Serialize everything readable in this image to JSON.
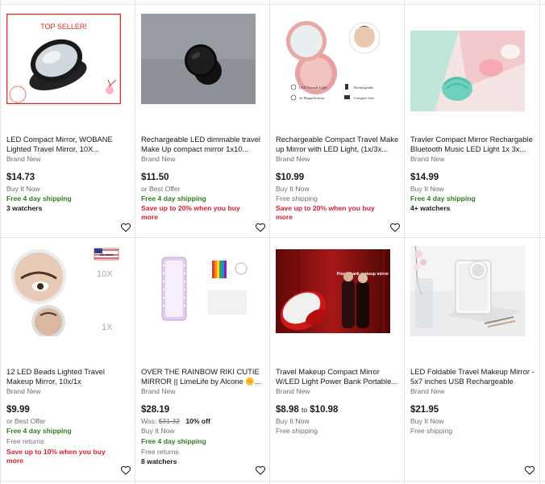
{
  "listings": [
    {
      "title": "LED Compact Mirror, WOBANE Lighted Travel Mirror, 10X...",
      "condition": "Brand New",
      "price": "$14.73",
      "lines": [
        {
          "text": "Buy It Now",
          "style": "gray"
        },
        {
          "text": "Free 4 day shipping",
          "style": "green"
        },
        {
          "text": "3 watchers",
          "style": "bold"
        }
      ],
      "badge_text": "TOP SELLER!",
      "badge_color": "#e0281e"
    },
    {
      "title": "Rechargeable LED dimmable travel Make Up compact mirror 1x10...",
      "condition": "Brand New",
      "price": "$11.50",
      "lines": [
        {
          "text": "or Best Offer",
          "style": "gray"
        },
        {
          "text": "Free 4 day shipping",
          "style": "green"
        },
        {
          "text": "Save up to 20% when you buy more",
          "style": "red"
        }
      ]
    },
    {
      "title": "Rechargeable Compact Travel Make up Mirror with LED Light, (1x/3x...",
      "condition": "Brand New",
      "price": "$10.99",
      "lines": [
        {
          "text": "Buy It Now",
          "style": "gray"
        },
        {
          "text": "Free shipping",
          "style": "gray"
        },
        {
          "text": "Save up to 20% when you buy more",
          "style": "red"
        }
      ],
      "image_labels": {
        "led": "LED Natural Light",
        "rechargeable": "Rechargeable",
        "magnification": "3x Magnification",
        "compact": "Compact Size"
      }
    },
    {
      "title": "Travler Compact Mirror Rechargable Bluetooth Music LED Light 1x 3x...",
      "condition": "Brand New",
      "price": "$14.99",
      "lines": [
        {
          "text": "Buy It Now",
          "style": "gray"
        },
        {
          "text": "Free 4 day shipping",
          "style": "green"
        },
        {
          "text": "4+ watchers",
          "style": "bold"
        }
      ]
    },
    {
      "title": "12 LED Beads Lighted Travel Makeup Mirror, 10x/1x Magnification...",
      "condition": "Brand New",
      "price": "$9.99",
      "lines": [
        {
          "text": "or Best Offer",
          "style": "gray"
        },
        {
          "text": "Free 4 day shipping",
          "style": "green"
        },
        {
          "text": "Free returns",
          "style": "gray"
        },
        {
          "text": "Save up to 10% when you buy more",
          "style": "red"
        }
      ],
      "image_labels": {
        "stock": "US stock",
        "mag_top": "10X",
        "mag_bottom": "1X"
      }
    },
    {
      "title": "OVER THE RAINBOW RIKI CUTIE MIRROR || LimeLife by Alcone 🌼...",
      "condition": "Brand New",
      "price": "$28.19",
      "was_label": "Was:",
      "was_price": "$31.32",
      "discount": "10% off",
      "lines": [
        {
          "text": "Buy It Now",
          "style": "gray"
        },
        {
          "text": "Free 4 day shipping",
          "style": "green"
        },
        {
          "text": "Free returns",
          "style": "gray"
        },
        {
          "text": "8 watchers",
          "style": "bold"
        }
      ]
    },
    {
      "title": "Travel Makeup Compact Mirror W/LED Light Power Bank Portable...",
      "condition": "Brand New",
      "price_from": "$8.98",
      "price_to_word": "to",
      "price_to": "$10.98",
      "lines": [
        {
          "text": "Buy It Now",
          "style": "gray"
        },
        {
          "text": "Free shipping",
          "style": "gray"
        }
      ],
      "image_labels": {
        "banner": "Power bank makeup mirror"
      }
    },
    {
      "title": "LED Foldable Travel Makeup Mirror - 5x7 inches USB Rechargeable",
      "condition": "Brand New",
      "price": "$21.95",
      "lines": [
        {
          "text": "Buy It Now",
          "style": "gray"
        },
        {
          "text": "Free shipping",
          "style": "gray"
        }
      ]
    }
  ],
  "icons": {
    "watch": "heart-outline-icon"
  },
  "colors": {
    "free_shipping": "#2e7d1f",
    "save_offer": "#dd1e31",
    "muted": "#707070",
    "divider": "#e5e5e5"
  }
}
